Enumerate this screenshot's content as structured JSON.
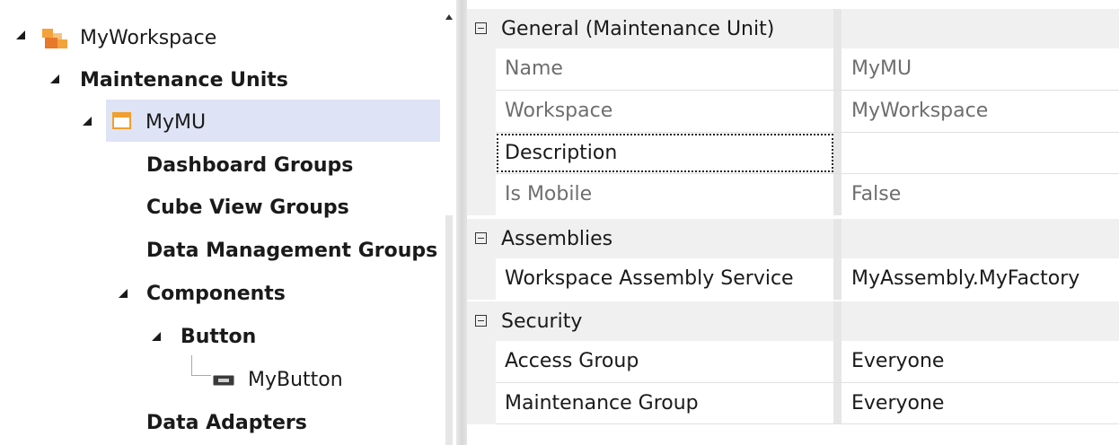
{
  "tree": {
    "workspace": "MyWorkspace",
    "maintenance_units": "Maintenance Units",
    "unit": "MyMU",
    "dashboard_groups": "Dashboard Groups",
    "cube_view_groups": "Cube View Groups",
    "data_management_groups": "Data Management Groups",
    "components": "Components",
    "button": "Button",
    "my_button": "MyButton",
    "data_adapters": "Data Adapters"
  },
  "properties": {
    "general": {
      "title": "General (Maintenance Unit)",
      "rows": [
        {
          "name": "Name",
          "value": "MyMU"
        },
        {
          "name": "Workspace",
          "value": "MyWorkspace"
        },
        {
          "name": "Description",
          "value": ""
        },
        {
          "name": "Is Mobile",
          "value": "False"
        }
      ]
    },
    "assemblies": {
      "title": "Assemblies",
      "rows": [
        {
          "name": "Workspace Assembly Service",
          "value": "MyAssembly.MyFactory"
        }
      ]
    },
    "security": {
      "title": "Security",
      "rows": [
        {
          "name": "Access Group",
          "value": "Everyone"
        },
        {
          "name": "Maintenance Group",
          "value": "Everyone"
        }
      ]
    }
  },
  "colors": {
    "selection": "#dfe3f6",
    "workspace_icon": "#f4a23c",
    "category_bg": "#f0f0f0"
  }
}
